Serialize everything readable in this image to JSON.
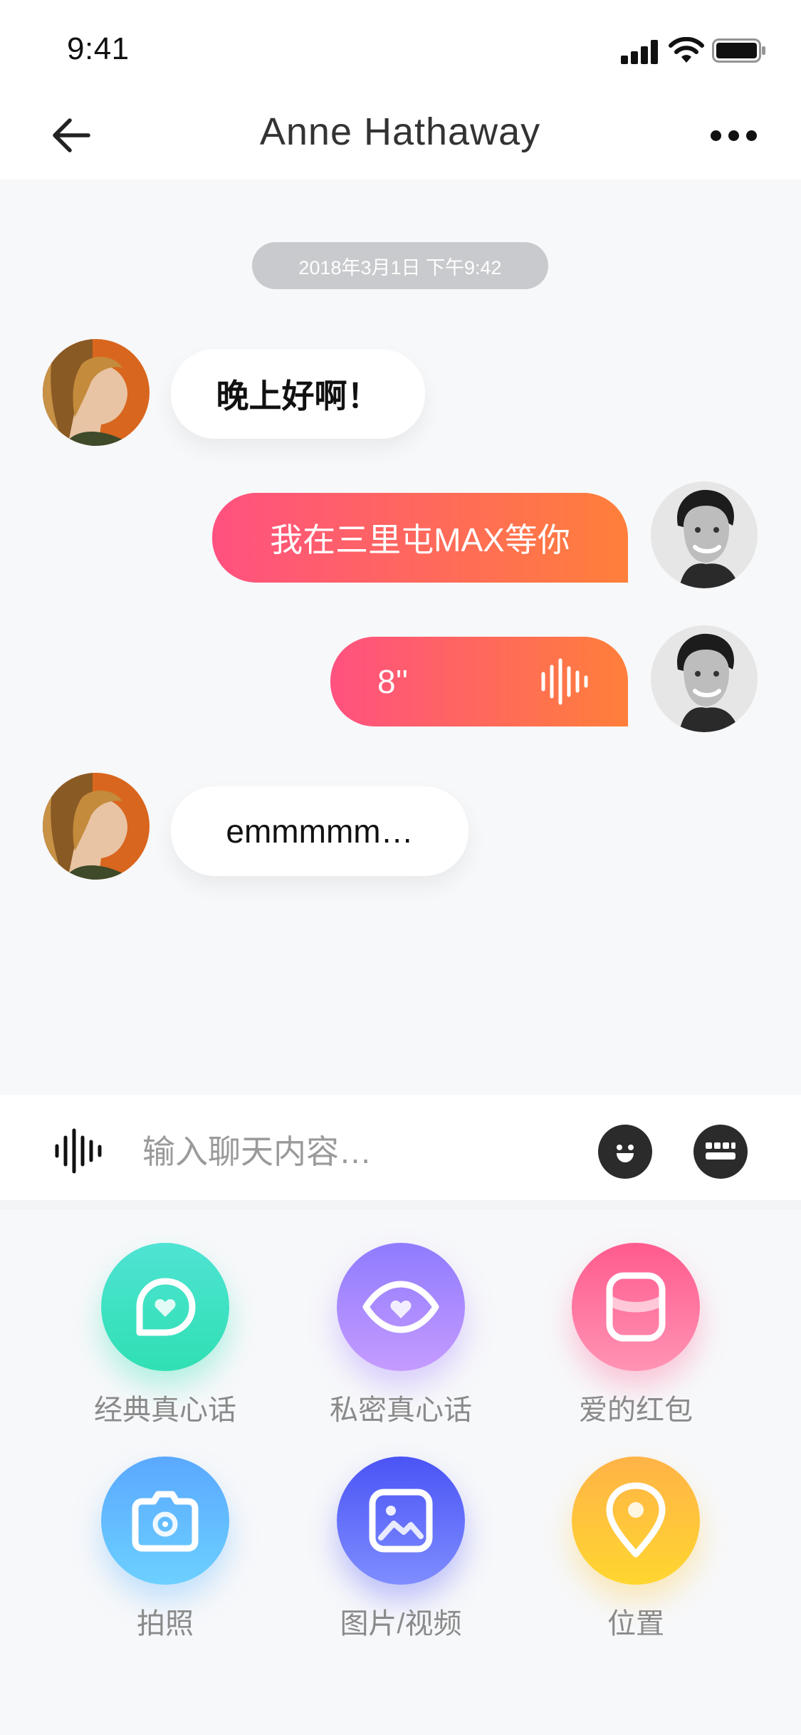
{
  "status_bar": {
    "time": "9:41"
  },
  "nav": {
    "title": "Anne Hathaway",
    "back_icon": "arrow-left-icon",
    "more_icon": "more-dots-icon"
  },
  "chat": {
    "timestamp": "2018年3月1日  下午9:42",
    "messages": [
      {
        "from": "them",
        "type": "text",
        "text": "晚上好啊！"
      },
      {
        "from": "me",
        "type": "text",
        "text": "我在三里屯MAX等你"
      },
      {
        "from": "me",
        "type": "voice",
        "duration": "8''"
      },
      {
        "from": "them",
        "type": "text",
        "text": "emmmmm…"
      }
    ]
  },
  "input_bar": {
    "placeholder": "输入聊天内容…",
    "voice_icon": "voice-wave-icon",
    "emoji_icon": "emoji-icon",
    "keyboard_icon": "keyboard-icon"
  },
  "features": [
    {
      "label": "经典真心话",
      "icon": "chat-heart-icon"
    },
    {
      "label": "私密真心话",
      "icon": "eye-heart-icon"
    },
    {
      "label": "爱的红包",
      "icon": "red-packet-icon"
    },
    {
      "label": "拍照",
      "icon": "camera-icon"
    },
    {
      "label": "图片/视频",
      "icon": "image-icon"
    },
    {
      "label": "位置",
      "icon": "location-pin-icon"
    }
  ],
  "colors": {
    "outgoing_gradient_start": "#ff5180",
    "outgoing_gradient_end": "#ff7f3a",
    "chat_background": "#f7f8fa"
  }
}
